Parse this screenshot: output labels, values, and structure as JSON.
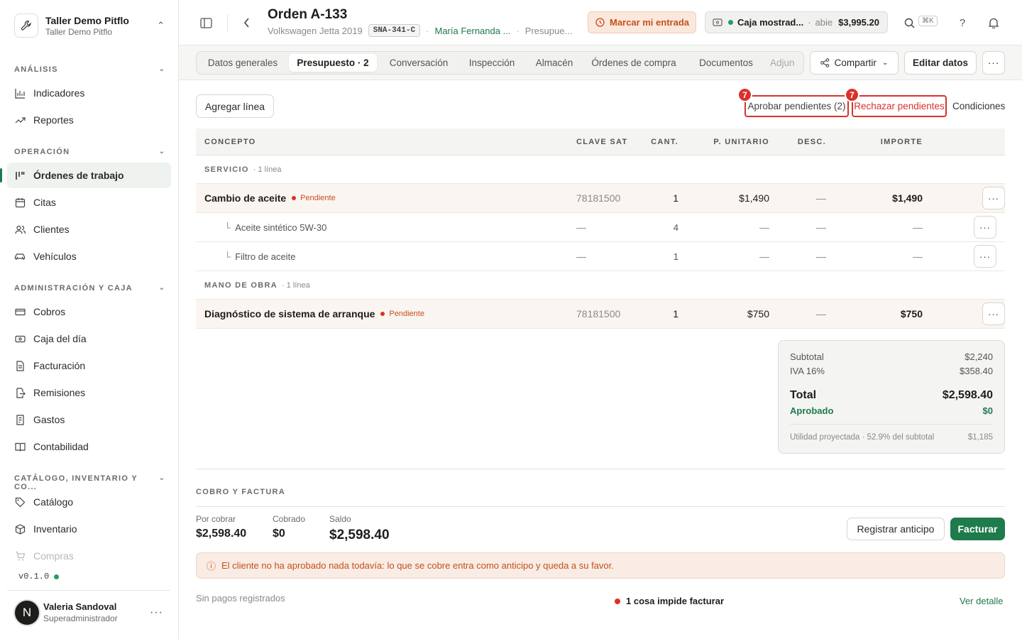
{
  "workspace": {
    "name": "Taller Demo Pitflo",
    "sub": "Taller Demo Pitflo"
  },
  "sidebar": {
    "sections": [
      {
        "label": "ANÁLISIS",
        "items": [
          {
            "label": "Indicadores",
            "icon": "bar-chart-icon"
          },
          {
            "label": "Reportes",
            "icon": "trend-icon"
          }
        ]
      },
      {
        "label": "OPERACIÓN",
        "items": [
          {
            "label": "Órdenes de trabajo",
            "icon": "kanban-icon",
            "active": true
          },
          {
            "label": "Citas",
            "icon": "calendar-icon"
          },
          {
            "label": "Clientes",
            "icon": "users-icon"
          },
          {
            "label": "Vehículos",
            "icon": "car-icon"
          }
        ]
      },
      {
        "label": "ADMINISTRACIÓN Y CAJA",
        "items": [
          {
            "label": "Cobros",
            "icon": "banknote-icon"
          },
          {
            "label": "Caja del día",
            "icon": "register-icon"
          },
          {
            "label": "Facturación",
            "icon": "invoice-icon"
          },
          {
            "label": "Remisiones",
            "icon": "file-export-icon"
          },
          {
            "label": "Gastos",
            "icon": "receipt-icon"
          },
          {
            "label": "Contabilidad",
            "icon": "book-icon"
          }
        ]
      },
      {
        "label": "CATÁLOGO, INVENTARIO Y CO...",
        "items": [
          {
            "label": "Catálogo",
            "icon": "tag-icon"
          },
          {
            "label": "Inventario",
            "icon": "box-icon"
          },
          {
            "label": "Compras",
            "icon": "cart-icon"
          }
        ]
      }
    ],
    "version": "v0.1.0",
    "user": {
      "initial": "N",
      "name": "Valeria Sandoval",
      "role": "Superadministrador"
    }
  },
  "header": {
    "title": "Orden A-133",
    "vehicle": "Volkswagen Jetta 2019",
    "plate": "SNA-341-C",
    "customer": "María Fernanda ...",
    "stage": "Presupue...",
    "entry_button": "Marcar mi entrada",
    "cash": {
      "name": "Caja mostrad...",
      "status": "abie",
      "amount": "$3,995.20"
    },
    "shortcut": "⌘K"
  },
  "tabs": [
    "Datos generales",
    "Presupuesto · 2",
    "Conversación",
    "Inspección",
    "Almacén",
    "Órdenes de compra",
    "Documentos",
    "Adjun"
  ],
  "toolbar": {
    "share": "Compartir",
    "edit": "Editar datos"
  },
  "quote": {
    "add_line": "Agregar línea",
    "approve": "Aprobar pendientes (2)",
    "reject": "Rechazar pendientes",
    "conditions": "Condiciones",
    "approve_badge": "7",
    "reject_badge": "7",
    "columns": [
      "CONCEPTO",
      "CLAVE SAT",
      "CANT.",
      "P. UNITARIO",
      "DESC.",
      "IMPORTE"
    ],
    "groups": [
      {
        "label": "SERVICIO",
        "count": "· 1 línea",
        "lines": [
          {
            "concept": "Cambio de aceite",
            "status": "Pendiente",
            "sat": "78181500",
            "qty": "1",
            "unit": "$1,490",
            "disc": "—",
            "amount": "$1,490",
            "subs": [
              {
                "concept": "Aceite sintético 5W-30",
                "sat": "—",
                "qty": "4",
                "unit": "—",
                "disc": "—",
                "amount": "—"
              },
              {
                "concept": "Filtro de aceite",
                "sat": "—",
                "qty": "1",
                "unit": "—",
                "disc": "—",
                "amount": "—"
              }
            ]
          }
        ]
      },
      {
        "label": "MANO DE OBRA",
        "count": "· 1 línea",
        "lines": [
          {
            "concept": "Diagnóstico de sistema de arranque",
            "status": "Pendiente",
            "sat": "78181500",
            "qty": "1",
            "unit": "$750",
            "disc": "—",
            "amount": "$750",
            "subs": []
          }
        ]
      }
    ],
    "totals": {
      "subtotal_label": "Subtotal",
      "subtotal": "$2,240",
      "iva_label": "IVA 16%",
      "iva": "$358.40",
      "total_label": "Total",
      "total": "$2,598.40",
      "approved_label": "Aprobado",
      "approved": "$0",
      "profit_label": "Utilidad proyectada · 52.9% del subtotal",
      "profit": "$1,185"
    }
  },
  "billing": {
    "title": "COBRO Y FACTURA",
    "por_cobrar_label": "Por cobrar",
    "por_cobrar": "$2,598.40",
    "cobrado_label": "Cobrado",
    "cobrado": "$0",
    "saldo_label": "Saldo",
    "saldo": "$2,598.40",
    "advance_button": "Registrar anticipo",
    "invoice_button": "Facturar",
    "alert": "El cliente no ha aprobado nada todavía: lo que se cobre entra como anticipo y queda a su favor.",
    "no_payments": "Sin pagos registrados",
    "blocker": "1 cosa impide facturar",
    "details": "Ver detalle"
  },
  "colors": {
    "accent": "#1f7a4c",
    "danger": "#d9322b",
    "warning": "#c4501c"
  }
}
